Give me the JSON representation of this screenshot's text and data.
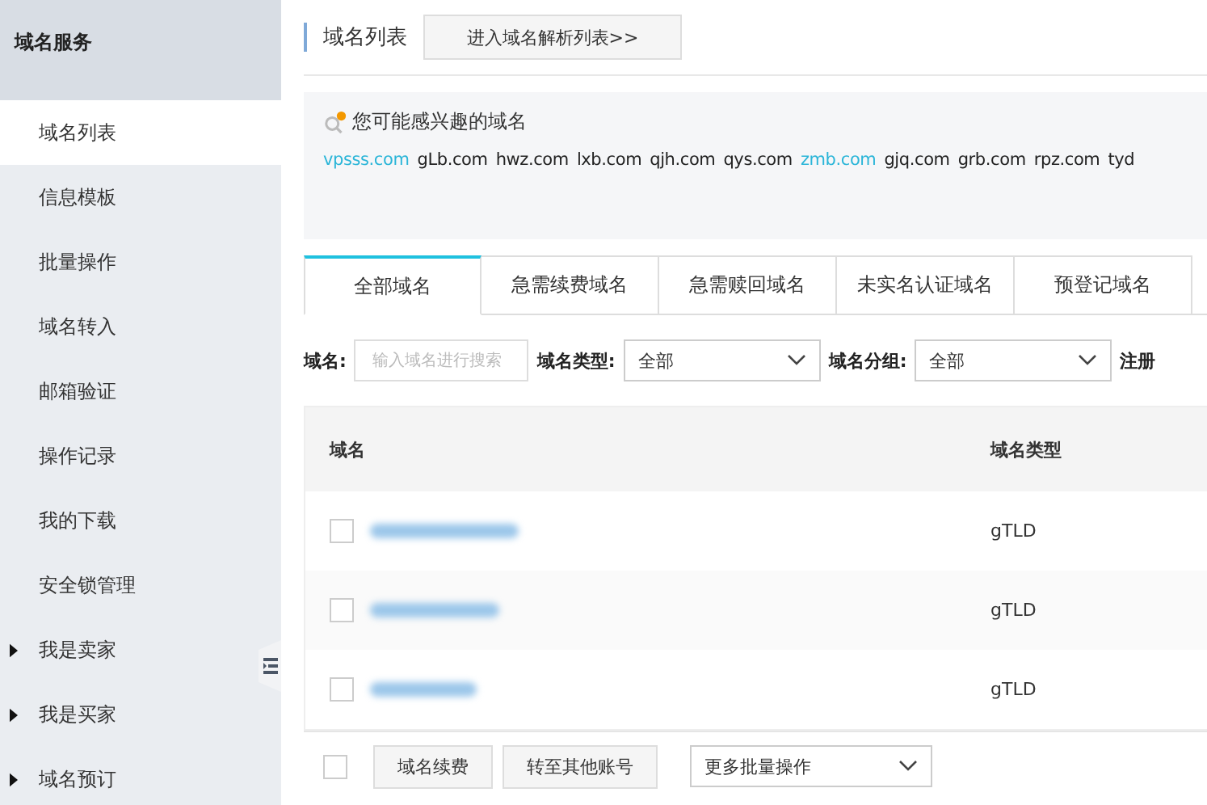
{
  "sidebar": {
    "title": "域名服务",
    "items": [
      {
        "label": "域名列表",
        "selected": true,
        "kind": "link"
      },
      {
        "label": "信息模板",
        "selected": false,
        "kind": "link"
      },
      {
        "label": "批量操作",
        "selected": false,
        "kind": "link"
      },
      {
        "label": "域名转入",
        "selected": false,
        "kind": "link"
      },
      {
        "label": "邮箱验证",
        "selected": false,
        "kind": "link"
      },
      {
        "label": "操作记录",
        "selected": false,
        "kind": "link"
      },
      {
        "label": "我的下载",
        "selected": false,
        "kind": "link"
      },
      {
        "label": "安全锁管理",
        "selected": false,
        "kind": "link"
      },
      {
        "label": "我是卖家",
        "selected": false,
        "kind": "group"
      },
      {
        "label": "我是买家",
        "selected": false,
        "kind": "group"
      },
      {
        "label": "域名预订",
        "selected": false,
        "kind": "group"
      }
    ]
  },
  "header": {
    "title": "域名列表",
    "button": "进入域名解析列表>>"
  },
  "suggestions": {
    "title": "您可能感兴趣的域名",
    "domains": [
      {
        "name": "vpsss.com",
        "highlighted": true
      },
      {
        "name": "gLb.com",
        "highlighted": false
      },
      {
        "name": "hwz.com",
        "highlighted": false
      },
      {
        "name": "lxb.com",
        "highlighted": false
      },
      {
        "name": "qjh.com",
        "highlighted": false
      },
      {
        "name": "qys.com",
        "highlighted": false
      },
      {
        "name": "zmb.com",
        "highlighted": true
      },
      {
        "name": "gjq.com",
        "highlighted": false
      },
      {
        "name": "grb.com",
        "highlighted": false
      },
      {
        "name": "rpz.com",
        "highlighted": false
      },
      {
        "name": "tyd",
        "highlighted": false
      }
    ]
  },
  "tabs": [
    {
      "label": "全部域名",
      "selected": true
    },
    {
      "label": "急需续费域名",
      "selected": false
    },
    {
      "label": "急需赎回域名",
      "selected": false
    },
    {
      "label": "未实名认证域名",
      "selected": false
    },
    {
      "label": "预登记域名",
      "selected": false
    }
  ],
  "filters": {
    "domain_label": "域名:",
    "domain_placeholder": "输入域名进行搜索",
    "type_label": "域名类型:",
    "type_value": "全部",
    "group_label": "域名分组:",
    "group_value": "全部",
    "column_4_label": "注册"
  },
  "table": {
    "columns": [
      "域名",
      "域名类型"
    ],
    "rows": [
      {
        "checked": false,
        "type": "gTLD"
      },
      {
        "checked": false,
        "type": "gTLD"
      },
      {
        "checked": false,
        "type": "gTLD"
      }
    ]
  },
  "footer": {
    "select_all_checked": false,
    "buttons": [
      "域名续费",
      "转至其他账号"
    ],
    "batch_select": "更多批量操作"
  }
}
